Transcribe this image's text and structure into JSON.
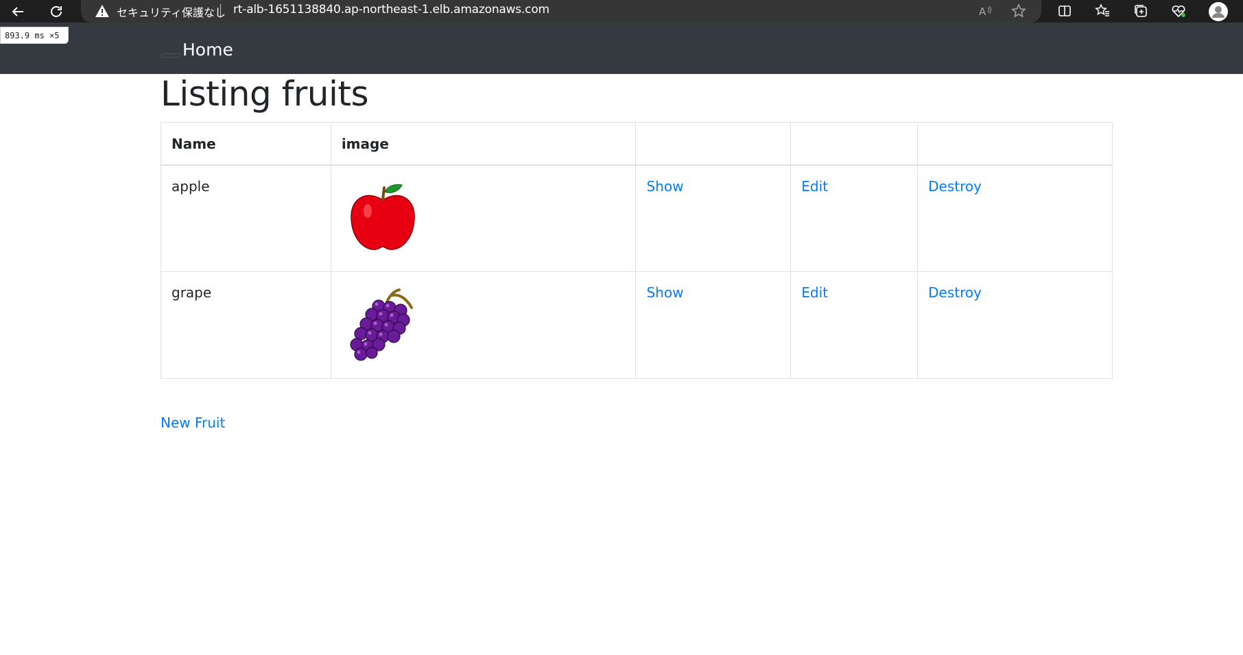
{
  "browser": {
    "security_label": "セキュリティ保護なし",
    "url": "rt-alb-1651138840.ap-northeast-1.elb.amazonaws.com",
    "timing_badge": "893.9 ms ×5"
  },
  "navbar": {
    "home_label": "Home"
  },
  "page": {
    "title": "Listing fruits"
  },
  "table": {
    "headers": [
      "Name",
      "image",
      "",
      "",
      ""
    ],
    "rows": [
      {
        "name": "apple",
        "image_icon": "apple-image",
        "show": "Show",
        "edit": "Edit",
        "destroy": "Destroy"
      },
      {
        "name": "grape",
        "image_icon": "grape-image",
        "show": "Show",
        "edit": "Edit",
        "destroy": "Destroy"
      }
    ]
  },
  "actions": {
    "new_label": "New Fruit"
  },
  "colors": {
    "navbar": "#343a40",
    "link": "#007bff",
    "text": "#212529",
    "chrome": "#1f1f1f"
  }
}
